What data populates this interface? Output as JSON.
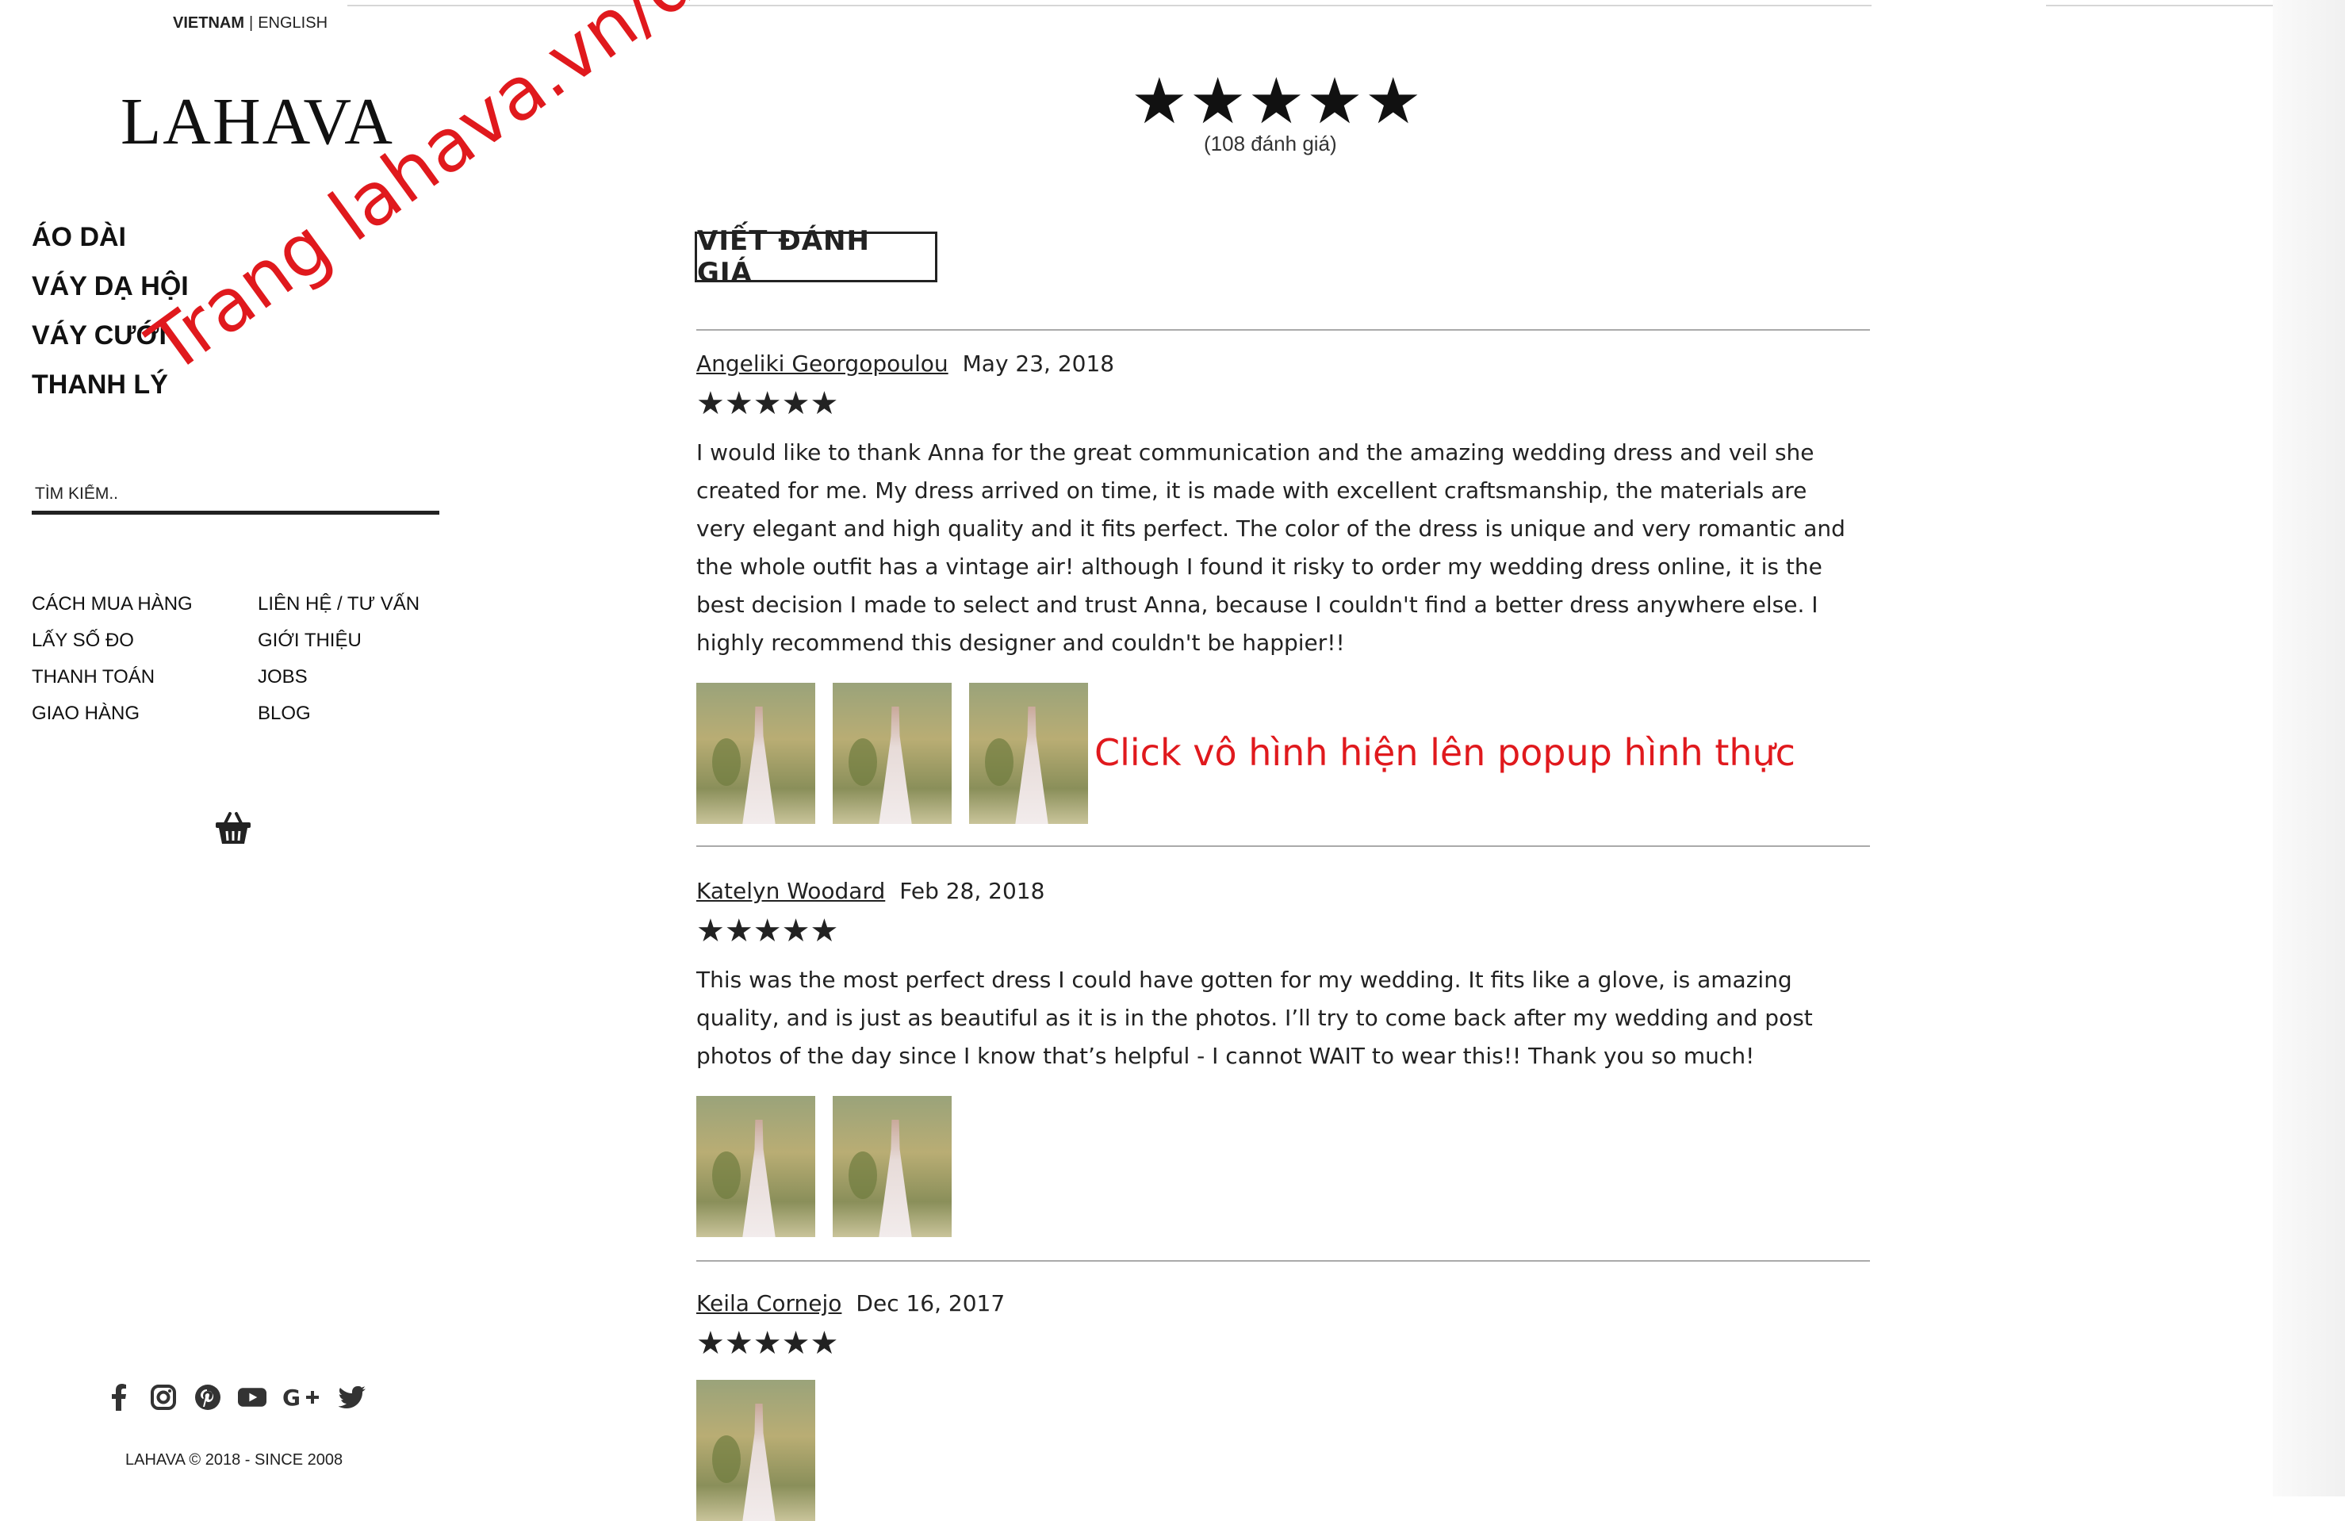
{
  "lang": {
    "active": "VIETNAM",
    "separator": "|",
    "other": "ENGLISH"
  },
  "brand": {
    "logo": "LAHAVA"
  },
  "nav": [
    "ÁO DÀI",
    "VÁY DẠ HỘI",
    "VÁY CƯỚI",
    "THANH LÝ"
  ],
  "search": {
    "placeholder": "TÌM KIẾM.."
  },
  "links": [
    "CÁCH MUA HÀNG",
    "LIÊN HỆ / TƯ VẤN",
    "LẤY SỐ ĐO",
    "GIỚI THIỆU",
    "THANH TOÁN",
    "JOBS",
    "GIAO HÀNG",
    "BLOG"
  ],
  "icons": {
    "cart": "basket-icon",
    "social": [
      "facebook-icon",
      "instagram-icon",
      "pinterest-icon",
      "youtube-icon",
      "google-plus-icon",
      "twitter-icon"
    ]
  },
  "footer": {
    "copyright": "LAHAVA © 2018 - SINCE 2008"
  },
  "annotation": {
    "watermark": "Trang lahava.vn/danhgia",
    "popup_note": "Click vô hình hiện lên popup hình thực"
  },
  "summary": {
    "stars": "★★★★★",
    "count": "(108  đánh giá)"
  },
  "write_review": "VIẾT ĐÁNH GIÁ",
  "reviews": [
    {
      "name": "Angeliki Georgopoulou",
      "date": "May 23, 2018",
      "stars": "★★★★★",
      "text": "I would like to thank Anna for the great communication and the amazing wedding dress and veil she created for me. My dress arrived on time, it is made with excellent craftsmanship, the materials are very elegant and high quality and it fits perfect. The color of the dress is unique and very romantic and the whole outfit has a vintage air! although I found it risky to order my wedding dress online, it is the best decision I made to select and trust Anna, because I couldn't find a better dress anywhere else. I highly recommend this designer and couldn't be happier!!"
    },
    {
      "name": "Katelyn Woodard",
      "date": "Feb 28, 2018",
      "stars": "★★★★★",
      "text": "This was the most perfect dress I could have gotten for my wedding. It fits like a glove, is amazing quality, and is just as beautiful as it is in the photos. I’ll try to come back after my wedding and post photos of the day since I know that’s helpful - I cannot WAIT to wear this!! Thank you so much!"
    },
    {
      "name": "Keila Cornejo",
      "date": "Dec 16, 2017",
      "stars": "★★★★★"
    }
  ],
  "colors": {
    "annotation_red": "#e0191d",
    "text": "#222222",
    "rule": "#aaaaaa"
  }
}
